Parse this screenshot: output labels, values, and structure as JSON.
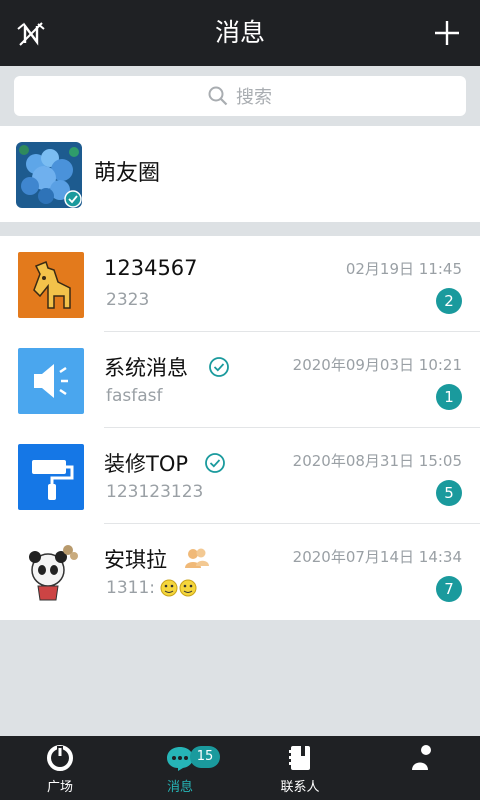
{
  "header": {
    "title": "消息"
  },
  "search": {
    "placeholder": "搜索"
  },
  "moments": {
    "label": "萌友圈"
  },
  "conversations": [
    {
      "name": "1234567",
      "time": "02月19日 11:45",
      "preview": "2323",
      "unread": "2"
    },
    {
      "name": "系统消息",
      "time": "2020年09月03日 10:21",
      "preview": "fasfasf",
      "unread": "1"
    },
    {
      "name": "装修TOP",
      "time": "2020年08月31日 15:05",
      "preview": "123123123",
      "unread": "5"
    },
    {
      "name": "安琪拉",
      "time": "2020年07月14日 14:34",
      "preview": "1311:",
      "unread": "7"
    }
  ],
  "tabs": [
    {
      "label": "广场"
    },
    {
      "label": "消息",
      "badge": "15"
    },
    {
      "label": "联系人"
    },
    {
      "label": ""
    }
  ],
  "colors": {
    "accent": "#1a9a9d",
    "bar": "#1f2124"
  }
}
